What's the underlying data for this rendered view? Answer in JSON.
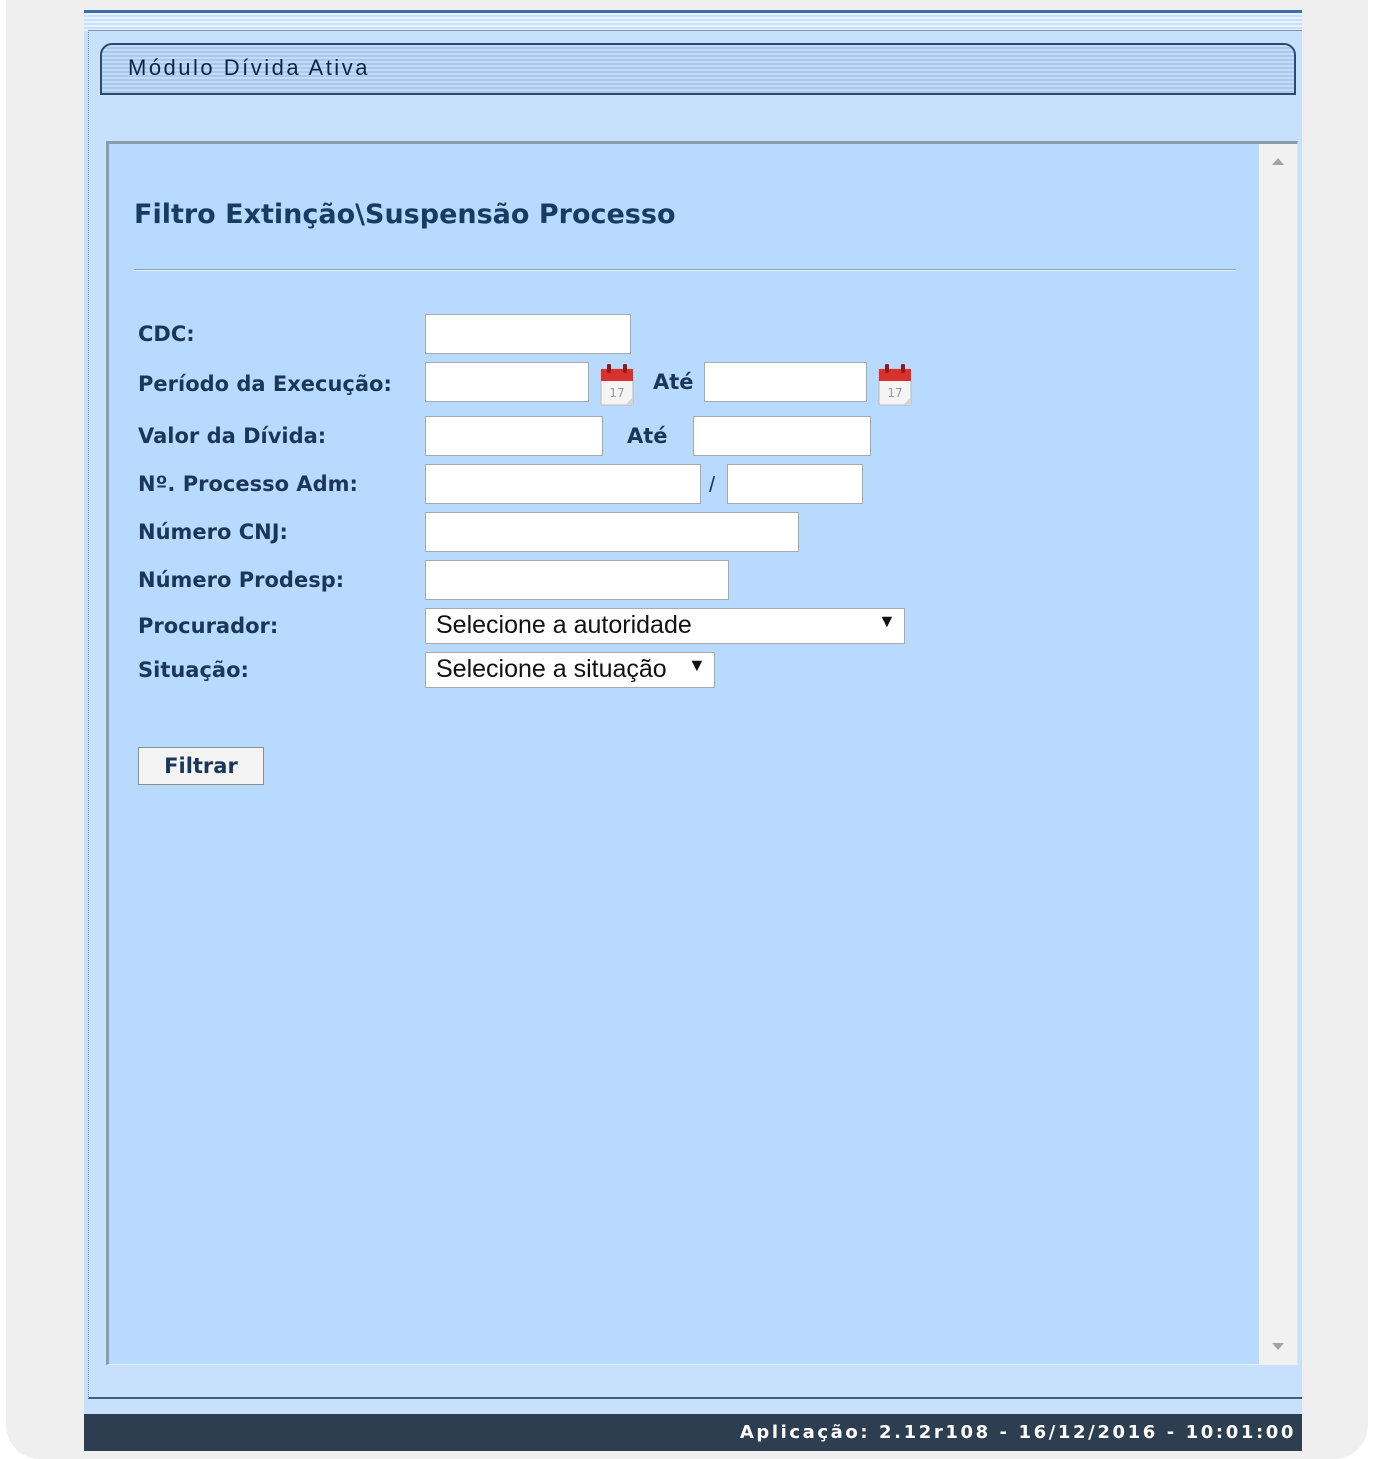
{
  "module": {
    "title": "Módulo Dívida Ativa"
  },
  "page": {
    "title": "Filtro Extinção\\Suspensão Processo"
  },
  "form": {
    "cdc": {
      "label": "CDC:",
      "value": ""
    },
    "periodo_execucao": {
      "label": "Período da Execução:",
      "from_value": "",
      "until_label": "Até",
      "to_value": ""
    },
    "valor_divida": {
      "label": "Valor da Dívida:",
      "from_value": "",
      "until_label": "Até",
      "to_value": ""
    },
    "processo_adm": {
      "label": "Nº. Processo Adm:",
      "number_value": "",
      "separator": "/",
      "year_value": ""
    },
    "numero_cnj": {
      "label": "Número CNJ:",
      "value": ""
    },
    "numero_prodesp": {
      "label": "Número Prodesp:",
      "value": ""
    },
    "procurador": {
      "label": "Procurador:",
      "selected": "Selecione a autoridade"
    },
    "situacao": {
      "label": "Situação:",
      "selected": "Selecione a situação"
    },
    "filter_button": "Filtrar"
  },
  "footer": {
    "text": "Aplicação: 2.12r108 - 16/12/2016 - 10:01:00"
  },
  "icons": {
    "calendar": "calendar-icon",
    "dropdown": "caret-down-icon"
  },
  "colors": {
    "panel": "#b8daff",
    "frame": "#c7e0fb",
    "footer": "#2c3e50",
    "heading": "#173b63"
  }
}
